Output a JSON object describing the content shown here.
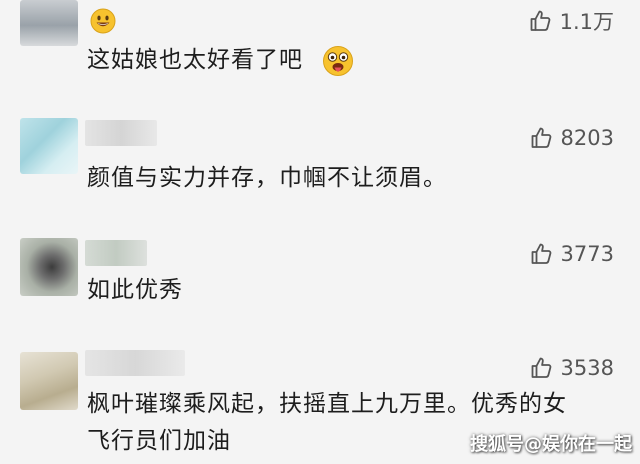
{
  "comments": [
    {
      "likes": "1.1万",
      "text": "这姑娘也太好看了吧"
    },
    {
      "likes": "8203",
      "text": "颜值与实力并存，巾帼不让须眉。"
    },
    {
      "likes": "3773",
      "text": "如此优秀"
    },
    {
      "likes": "3538",
      "text_line1": "枫叶璀璨乘风起，扶摇直上九万里。优秀的女",
      "text_line2": "飞行员们加油"
    }
  ],
  "watermark": "搜狐号@娱你在一起",
  "colors": {
    "background": "#f4f4f4",
    "text": "#1d1d1d",
    "like": "#555555",
    "emoji_yellow": "#f7c22e"
  },
  "icons": [
    "thumbs-up-icon",
    "smile-emoji-icon",
    "tongue-emoji-icon"
  ]
}
